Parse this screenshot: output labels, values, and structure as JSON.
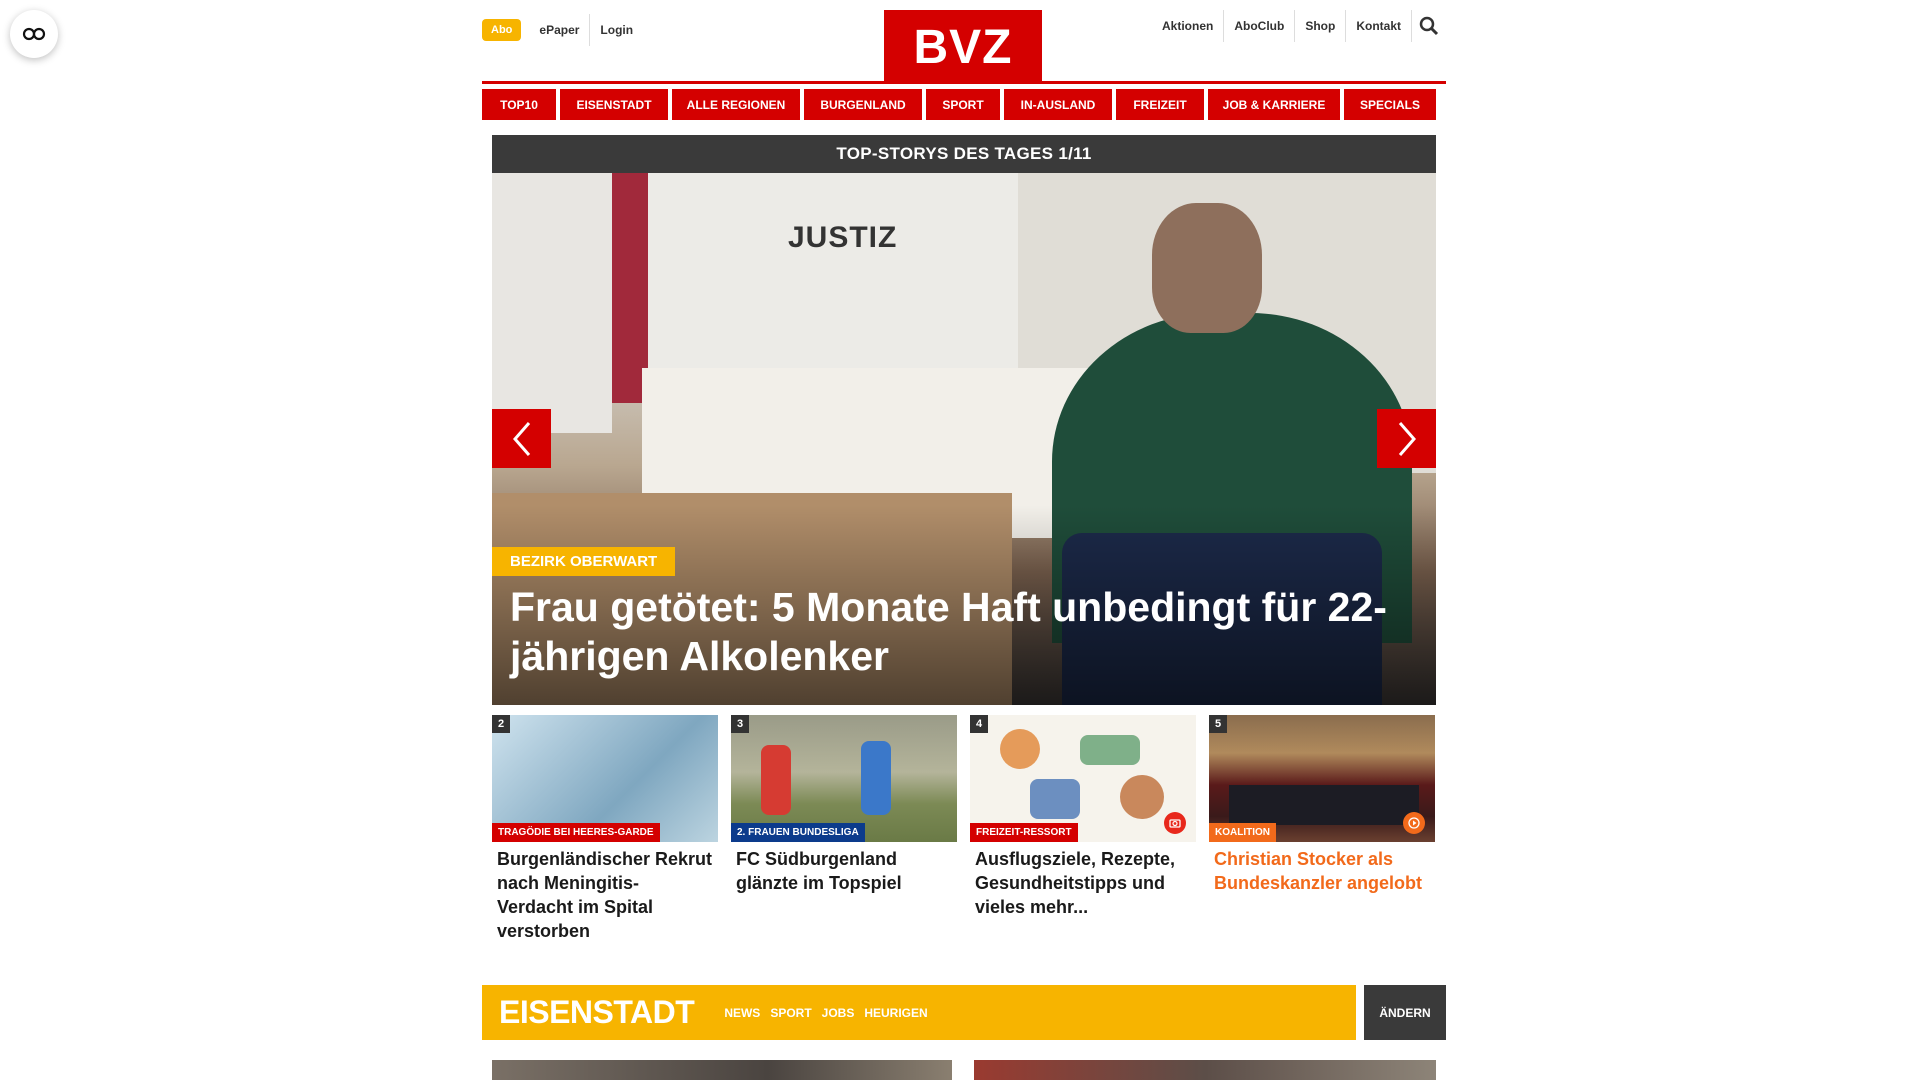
{
  "header": {
    "abo": "Abo",
    "epaper": "ePaper",
    "login": "Login",
    "logo": "BVZ",
    "right_links": [
      "Aktionen",
      "AboClub",
      "Shop",
      "Kontakt"
    ]
  },
  "nav": [
    "TOP10",
    "EISENSTADT",
    "ALLE REGIONEN",
    "BURGENLAND",
    "SPORT",
    "IN-AUSLAND",
    "FREIZEIT",
    "JOB & KARRIERE",
    "SPECIALS"
  ],
  "hero": {
    "heading": "TOP-STORYS DES TAGES 1/11",
    "image_text": "JUSTIZ",
    "tag": "BEZIRK OBERWART",
    "title": "Frau getötet: 5 Monate Haft unbedingt für 22-jährigen Alkolenker"
  },
  "cards": [
    {
      "num": "2",
      "tag": "TRAGÖDIE BEI HEERES-GARDE",
      "tag_color": "#d40000",
      "title": "Burgenländischer Rekrut nach Meningitis-Verdacht im Spital verstorben"
    },
    {
      "num": "3",
      "tag": "2. FRAUEN BUNDESLIGA",
      "tag_color": "#0c3b8c",
      "title": "FC Südburgenland glänzte im Topspiel"
    },
    {
      "num": "4",
      "tag": "FREIZEIT-RESSORT",
      "tag_color": "#d40000",
      "title": "Ausflugsziele, Rezepte, Gesundheitstipps und vieles mehr...",
      "icon": "camera-icon"
    },
    {
      "num": "5",
      "tag": "KOALITION",
      "tag_color": "#f26a1b",
      "title": "Christian Stocker als Bundeskanzler angelobt",
      "icon": "play-icon"
    }
  ],
  "section": {
    "title": "EISENSTADT",
    "links": [
      "NEWS",
      "SPORT",
      "JOBS",
      "HEURIGEN"
    ],
    "button": "ÄNDERN"
  },
  "colors": {
    "brand_red": "#d40000",
    "accent_yellow": "#f7b400",
    "dark_gray": "#3a3a3a",
    "orange": "#f26a1b"
  }
}
